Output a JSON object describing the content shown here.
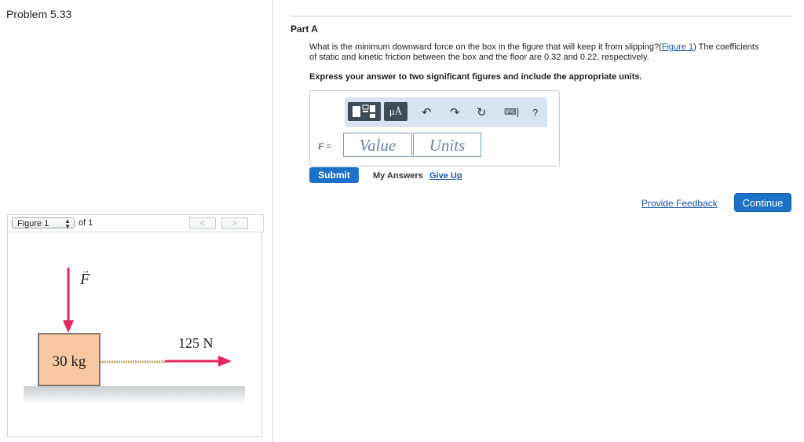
{
  "problem": {
    "title": "Problem 5.33"
  },
  "figure_nav": {
    "selected": "Figure 1",
    "of_label": "of 1",
    "prev": "<",
    "next": ">"
  },
  "figure": {
    "force_label": "F",
    "mass_label": "30 kg",
    "applied_force_label": "125 N",
    "arrow_color": "#e8265e",
    "box_color": "#f8c8a0"
  },
  "part": {
    "title": "Part A",
    "question_before": "What is the minimum downward force on the box in the figure that will keep it from slipping?(",
    "question_link": "Figure 1",
    "question_after": ") The coefficients of static and kinetic friction between the box and the floor are 0.32 and 0.22, respectively.",
    "instruction": "Express your answer to two significant figures and include the appropriate units."
  },
  "answer": {
    "variable": "F",
    "equals": "=",
    "value_placeholder": "Value",
    "units_placeholder": "Units",
    "toolbar_units_label": "μÅ",
    "help": "?"
  },
  "actions": {
    "submit": "Submit",
    "my_answers": "My Answers",
    "give_up": "Give Up",
    "provide_feedback": "Provide Feedback",
    "continue": "Continue"
  },
  "colors": {
    "accent": "#1c72c9",
    "link": "#1a56a6",
    "toolbar_bg": "#d6e4f3"
  }
}
